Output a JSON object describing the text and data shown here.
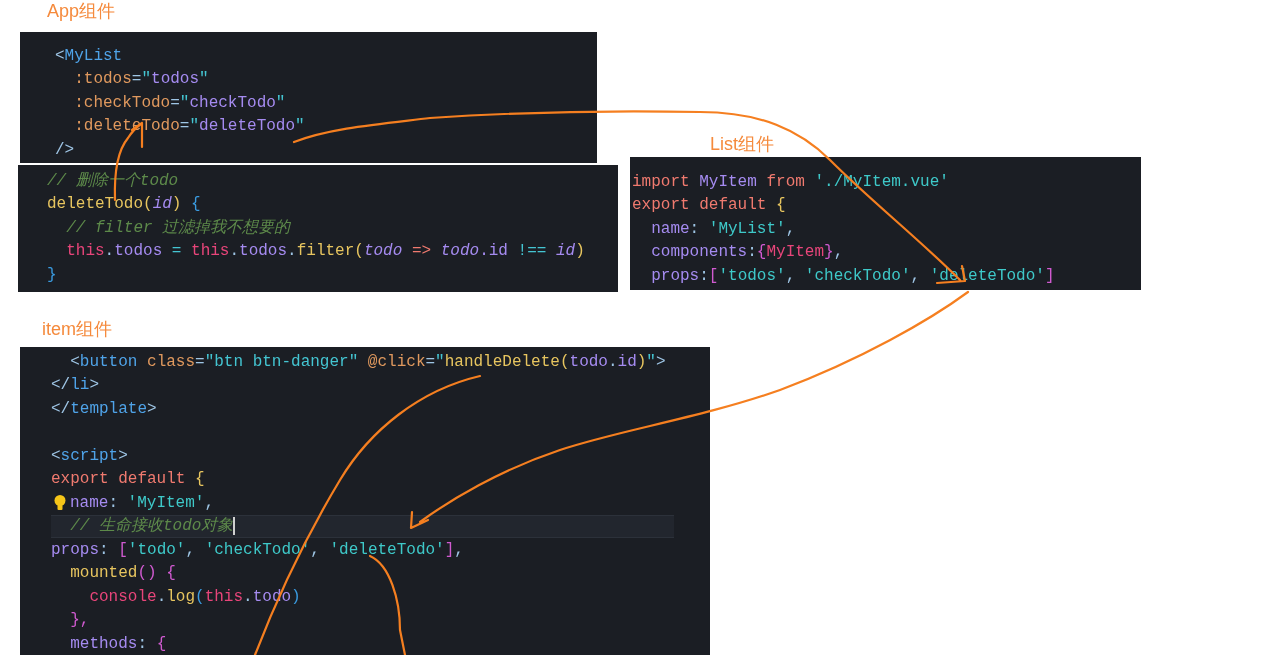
{
  "panels": [
    {
      "label": "App组件",
      "lines": [
        {
          "tokens": [
            {
              "text": "<",
              "kind": "punct"
            },
            {
              "text": "MyList",
              "kind": "tag"
            }
          ]
        },
        {
          "tokens": [
            {
              "text": "  :todos",
              "kind": "attr"
            },
            {
              "text": "=",
              "kind": "punct"
            },
            {
              "text": "\"",
              "kind": "quote"
            },
            {
              "text": "todos",
              "kind": "value"
            },
            {
              "text": "\"",
              "kind": "quote"
            }
          ]
        },
        {
          "tokens": [
            {
              "text": "  :checkTodo",
              "kind": "attr"
            },
            {
              "text": "=",
              "kind": "punct"
            },
            {
              "text": "\"",
              "kind": "quote"
            },
            {
              "text": "checkTodo",
              "kind": "value"
            },
            {
              "text": "\"",
              "kind": "quote"
            }
          ]
        },
        {
          "tokens": [
            {
              "text": "  :deleteTodo",
              "kind": "attr"
            },
            {
              "text": "=",
              "kind": "punct"
            },
            {
              "text": "\"",
              "kind": "quote"
            },
            {
              "text": "deleteTodo",
              "kind": "value"
            },
            {
              "text": "\"",
              "kind": "quote"
            }
          ]
        },
        {
          "tokens": [
            {
              "text": "/>",
              "kind": "punct"
            }
          ]
        }
      ]
    },
    {
      "lines": [
        {
          "tokens": [
            {
              "text": "// 删除一个todo",
              "kind": "comment"
            }
          ]
        },
        {
          "tokens": [
            {
              "text": "deleteTodo",
              "kind": "func"
            },
            {
              "text": "(",
              "kind": "func"
            },
            {
              "text": "id",
              "kind": "param"
            },
            {
              "text": ")",
              "kind": "func"
            },
            {
              "text": " {",
              "kind": "brace"
            }
          ]
        },
        {
          "tokens": [
            {
              "text": "  // filter 过滤掉我不想要的",
              "kind": "comment"
            }
          ]
        },
        {
          "tokens": [
            {
              "text": "  this",
              "kind": "this"
            },
            {
              "text": ".",
              "kind": "punct"
            },
            {
              "text": "todos",
              "kind": "prop"
            },
            {
              "text": " = ",
              "kind": "op"
            },
            {
              "text": "this",
              "kind": "this"
            },
            {
              "text": ".",
              "kind": "punct"
            },
            {
              "text": "todos",
              "kind": "prop"
            },
            {
              "text": ".",
              "kind": "punct"
            },
            {
              "text": "filter",
              "kind": "func"
            },
            {
              "text": "(",
              "kind": "func"
            },
            {
              "text": "todo",
              "kind": "param"
            },
            {
              "text": " => ",
              "kind": "keyword"
            },
            {
              "text": "todo",
              "kind": "param"
            },
            {
              "text": ".id",
              "kind": "prop"
            },
            {
              "text": " !== ",
              "kind": "op"
            },
            {
              "text": "id",
              "kind": "param"
            },
            {
              "text": ")",
              "kind": "func"
            }
          ]
        },
        {
          "tokens": [
            {
              "text": "}",
              "kind": "brace"
            }
          ]
        }
      ]
    },
    {
      "label": "List组件",
      "lines": [
        {
          "tokens": [
            {
              "text": "import",
              "kind": "keyword"
            },
            {
              "text": " MyItem ",
              "kind": "prop"
            },
            {
              "text": "from",
              "kind": "keyword"
            },
            {
              "text": " './MyItem.vue'",
              "kind": "string"
            }
          ]
        },
        {
          "tokens": [
            {
              "text": "export default",
              "kind": "keyword"
            },
            {
              "text": " {",
              "kind": "func"
            }
          ]
        },
        {
          "tokens": [
            {
              "text": "  name",
              "kind": "prop"
            },
            {
              "text": ": ",
              "kind": "punct"
            },
            {
              "text": "'MyList'",
              "kind": "string"
            },
            {
              "text": ",",
              "kind": "punct"
            }
          ]
        },
        {
          "tokens": [
            {
              "text": "  components",
              "kind": "prop"
            },
            {
              "text": ":",
              "kind": "punct"
            },
            {
              "text": "{",
              "kind": "magenta"
            },
            {
              "text": "MyItem",
              "kind": "this"
            },
            {
              "text": "}",
              "kind": "magenta"
            },
            {
              "text": ",",
              "kind": "punct"
            }
          ]
        },
        {
          "tokens": [
            {
              "text": "  props",
              "kind": "prop"
            },
            {
              "text": ":",
              "kind": "punct"
            },
            {
              "text": "[",
              "kind": "magenta"
            },
            {
              "text": "'todos'",
              "kind": "string"
            },
            {
              "text": ", ",
              "kind": "punct"
            },
            {
              "text": "'checkTodo'",
              "kind": "string"
            },
            {
              "text": ", ",
              "kind": "punct"
            },
            {
              "text": "'deleteTodo'",
              "kind": "string"
            },
            {
              "text": "]",
              "kind": "magenta"
            }
          ]
        }
      ]
    },
    {
      "label": "item组件",
      "lines": [
        {
          "tokens": [
            {
              "text": "  <",
              "kind": "punct"
            },
            {
              "text": "button",
              "kind": "tag"
            },
            {
              "text": " class",
              "kind": "attr"
            },
            {
              "text": "=",
              "kind": "punct"
            },
            {
              "text": "\"btn btn-danger\"",
              "kind": "quote"
            },
            {
              "text": " @click",
              "kind": "attr"
            },
            {
              "text": "=",
              "kind": "punct"
            },
            {
              "text": "\"",
              "kind": "quote"
            },
            {
              "text": "handleDelete",
              "kind": "func"
            },
            {
              "text": "(",
              "kind": "func"
            },
            {
              "text": "todo",
              "kind": "value"
            },
            {
              "text": ".",
              "kind": "punct"
            },
            {
              "text": "id",
              "kind": "value"
            },
            {
              "text": ")",
              "kind": "func"
            },
            {
              "text": "\"",
              "kind": "quote"
            },
            {
              "text": ">",
              "kind": "punct"
            }
          ]
        },
        {
          "tokens": [
            {
              "text": "</",
              "kind": "punct"
            },
            {
              "text": "li",
              "kind": "tag"
            },
            {
              "text": ">",
              "kind": "punct"
            }
          ]
        },
        {
          "tokens": [
            {
              "text": "</",
              "kind": "punct"
            },
            {
              "text": "template",
              "kind": "tag"
            },
            {
              "text": ">",
              "kind": "punct"
            }
          ]
        },
        {
          "blank_line_before": true,
          "tokens": [
            {
              "text": "<",
              "kind": "punct"
            },
            {
              "text": "script",
              "kind": "tag"
            },
            {
              "text": ">",
              "kind": "punct"
            }
          ]
        },
        {
          "tokens": [
            {
              "text": "export default",
              "kind": "keyword"
            },
            {
              "text": " {",
              "kind": "func"
            }
          ]
        },
        {
          "hint": true,
          "tokens": [
            {
              "text": "name",
              "kind": "prop"
            },
            {
              "text": ": ",
              "kind": "punct"
            },
            {
              "text": "'MyItem'",
              "kind": "string"
            },
            {
              "text": ",",
              "kind": "punct"
            }
          ]
        },
        {
          "current": true,
          "tokens": [
            {
              "text": "  // 生命接收todo对象",
              "kind": "comment"
            }
          ]
        },
        {
          "tokens": [
            {
              "text": "props",
              "kind": "prop"
            },
            {
              "text": ": ",
              "kind": "punct"
            },
            {
              "text": "[",
              "kind": "magenta"
            },
            {
              "text": "'todo'",
              "kind": "string"
            },
            {
              "text": ", ",
              "kind": "punct"
            },
            {
              "text": "'checkTodo'",
              "kind": "string"
            },
            {
              "text": ", ",
              "kind": "punct"
            },
            {
              "text": "'deleteTodo'",
              "kind": "string"
            },
            {
              "text": "]",
              "kind": "magenta"
            },
            {
              "text": ",",
              "kind": "punct"
            }
          ]
        },
        {
          "tokens": [
            {
              "text": "  mounted",
              "kind": "func"
            },
            {
              "text": "() {",
              "kind": "magenta"
            }
          ]
        },
        {
          "tokens": [
            {
              "text": "    console",
              "kind": "this"
            },
            {
              "text": ".",
              "kind": "punct"
            },
            {
              "text": "log",
              "kind": "func"
            },
            {
              "text": "(",
              "kind": "brace"
            },
            {
              "text": "this",
              "kind": "this"
            },
            {
              "text": ".",
              "kind": "punct"
            },
            {
              "text": "todo",
              "kind": "prop"
            },
            {
              "text": ")",
              "kind": "brace"
            }
          ]
        },
        {
          "tokens": [
            {
              "text": "  },",
              "kind": "magenta"
            }
          ]
        },
        {
          "tokens": [
            {
              "text": "  methods",
              "kind": "prop"
            },
            {
              "text": ": ",
              "kind": "punct"
            },
            {
              "text": "{",
              "kind": "magenta"
            }
          ]
        }
      ]
    }
  ]
}
